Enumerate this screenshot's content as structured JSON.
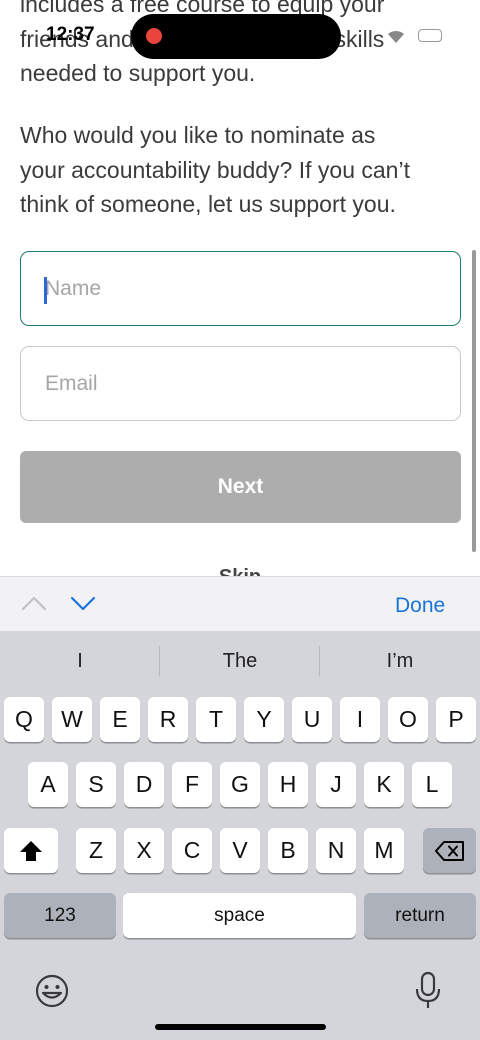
{
  "status_bar": {
    "time": "12:37"
  },
  "content": {
    "paragraph_top_lines": [
      "includes a free course to equip your",
      "friends and family with the key skills",
      "needed to support you."
    ],
    "paragraph_2_lines": [
      "Who would you like to nominate as",
      "your accountability buddy? If you can’t",
      "think of someone, let us support you."
    ],
    "name_placeholder": "Name",
    "email_placeholder": "Email",
    "next_label": "Next",
    "skip_label": "Skip"
  },
  "accessory_bar": {
    "done_label": "Done"
  },
  "keyboard": {
    "suggestions": [
      "I",
      "The",
      "I’m"
    ],
    "row1": [
      "Q",
      "W",
      "E",
      "R",
      "T",
      "Y",
      "U",
      "I",
      "O",
      "P"
    ],
    "row2": [
      "A",
      "S",
      "D",
      "F",
      "G",
      "H",
      "J",
      "K",
      "L"
    ],
    "row3": [
      "Z",
      "X",
      "C",
      "V",
      "B",
      "N",
      "M"
    ],
    "numbers_label": "123",
    "space_label": "space",
    "return_label": "return"
  }
}
